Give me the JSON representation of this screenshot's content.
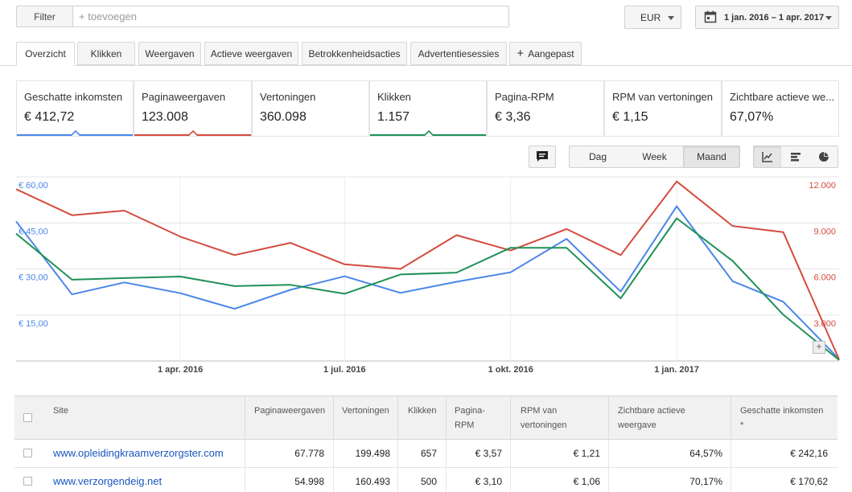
{
  "toolbar": {
    "filter_label": "Filter",
    "filter_placeholder": "+ toevoegen",
    "currency": "EUR",
    "date_range": "1 jan. 2016 – 1 apr. 2017"
  },
  "tabs": [
    {
      "label": "Overzicht",
      "active": true
    },
    {
      "label": "Klikken",
      "active": false
    },
    {
      "label": "Weergaven",
      "active": false
    },
    {
      "label": "Actieve weergaven",
      "active": false
    },
    {
      "label": "Betrokkenheidsacties",
      "active": false
    },
    {
      "label": "Advertentiesessies",
      "active": false
    },
    {
      "label": "Aangepast",
      "active": false,
      "icon": "plus-icon"
    }
  ],
  "metrics": [
    {
      "label": "Geschatte inkomsten",
      "value": "€ 412,72",
      "color": "#4a86e8",
      "selected": true
    },
    {
      "label": "Paginaweergaven",
      "value": "123.008",
      "color": "#d44b3f",
      "selected": true
    },
    {
      "label": "Vertoningen",
      "value": "360.098",
      "color": "",
      "selected": false
    },
    {
      "label": "Klikken",
      "value": "1.157",
      "color": "#1e9157",
      "selected": true
    },
    {
      "label": "Pagina-RPM",
      "value": "€ 3,36",
      "color": "",
      "selected": false
    },
    {
      "label": "RPM van vertoningen",
      "value": "€ 1,15",
      "color": "",
      "selected": false
    },
    {
      "label": "Zichtbare actieve we...",
      "value": "67,07%",
      "color": "",
      "selected": false
    }
  ],
  "controls": {
    "annotation_icon": "comment-icon",
    "granularity": [
      {
        "label": "Dag",
        "active": false
      },
      {
        "label": "Week",
        "active": false
      },
      {
        "label": "Maand",
        "active": true
      }
    ],
    "view_icons": [
      "line-chart-icon",
      "bar-chart-icon",
      "pie-chart-icon"
    ]
  },
  "chart_data": {
    "type": "line",
    "x": [
      "2016-01-01",
      "2016-02-01",
      "2016-03-01",
      "2016-04-01",
      "2016-05-01",
      "2016-06-01",
      "2016-07-01",
      "2016-08-01",
      "2016-09-01",
      "2016-10-01",
      "2016-11-01",
      "2016-12-01",
      "2017-01-01",
      "2017-02-01",
      "2017-03-01",
      "2017-04-01"
    ],
    "x_ticks": [
      "1 apr. 2016",
      "1 jul. 2016",
      "1 okt. 2016",
      "1 jan. 2017"
    ],
    "y_left_ticks": [
      "€ 15,00",
      "€ 30,00",
      "€ 45,00",
      "€ 60,00"
    ],
    "y_left_range": [
      0,
      60
    ],
    "y_right_ticks": [
      "3.000",
      "6.000",
      "9.000",
      "12.000"
    ],
    "y_right_range": [
      0,
      12000
    ],
    "grid": true,
    "series": [
      {
        "name": "Geschatte inkomsten",
        "axis": "left",
        "color": "#4a86e8",
        "values": [
          45.5,
          21.7,
          25.6,
          22.1,
          17.0,
          23.2,
          27.6,
          22.2,
          25.8,
          28.9,
          39.8,
          22.6,
          50.4,
          26.0,
          19.3,
          0.6
        ]
      },
      {
        "name": "Paginaweergaven",
        "axis": "right",
        "color": "#d44b3f",
        "values": [
          11200,
          9500,
          9800,
          8100,
          6900,
          7700,
          6300,
          6000,
          8200,
          7200,
          8600,
          6900,
          11700,
          8800,
          8400,
          100
        ]
      },
      {
        "name": "Klikken",
        "axis": "left",
        "color": "#1e9157",
        "values": [
          41.5,
          26.5,
          27.0,
          27.5,
          24.4,
          24.8,
          21.9,
          28.2,
          28.8,
          36.9,
          36.9,
          20.4,
          46.5,
          32.6,
          15.1,
          0.3
        ]
      }
    ]
  },
  "table": {
    "headers": [
      "Site",
      "Paginaweergaven",
      "Vertoningen",
      "Klikken",
      "Pagina-RPM",
      "RPM van vertoningen",
      "Zichtbare actieve weergave",
      "Geschatte inkomsten *"
    ],
    "rows": [
      {
        "site": "www.opleidingkraamverzorgster.com",
        "pageviews": "67.778",
        "impressions": "199.498",
        "clicks": "657",
        "page_rpm": "€ 3,57",
        "imp_rpm": "€ 1,21",
        "viewable": "64,57%",
        "earnings": "€ 242,16"
      },
      {
        "site": "www.verzorgendeig.net",
        "pageviews": "54.998",
        "impressions": "160.493",
        "clicks": "500",
        "page_rpm": "€ 3,10",
        "imp_rpm": "€ 1,06",
        "viewable": "70,17%",
        "earnings": "€ 170,62"
      }
    ]
  }
}
